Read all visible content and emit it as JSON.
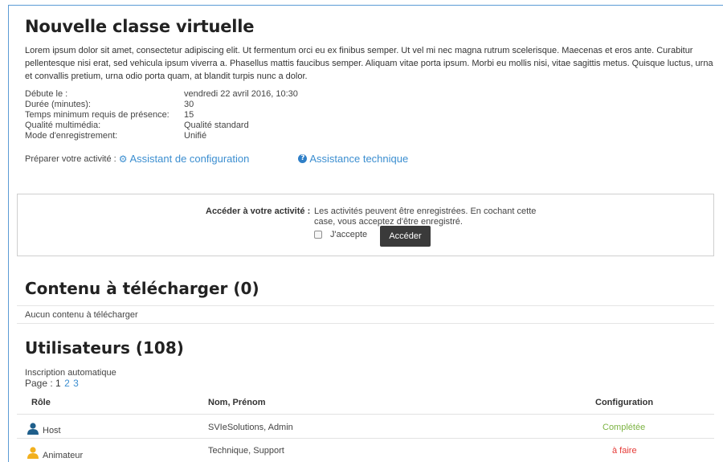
{
  "title": "Nouvelle classe virtuelle",
  "description": "Lorem ipsum dolor sit amet, consectetur adipiscing elit. Ut fermentum orci eu ex finibus semper. Ut vel mi nec magna rutrum scelerisque. Maecenas et eros ante. Curabitur pellentesque nisi erat, sed vehicula ipsum viverra a. Phasellus mattis faucibus semper. Aliquam vitae porta ipsum. Morbi eu mollis nisi, vitae sagittis metus. Quisque luctus, urna et convallis pretium, urna odio porta quam, at blandit turpis nunc a dolor.",
  "details": [
    {
      "label": "Débute le :",
      "value": "vendredi 22 avril 2016, 10:30"
    },
    {
      "label": "Durée (minutes):",
      "value": "30"
    },
    {
      "label": "Temps minimum requis de présence:",
      "value": "15"
    },
    {
      "label": "Qualité multimédia:",
      "value": "Qualité standard"
    },
    {
      "label": "Mode d'enregistrement:",
      "value": "Unifié"
    }
  ],
  "prepare": {
    "label": "Préparer votre activité :",
    "wizard_icon": "gear-icon",
    "wizard_link": "Assistant de configuration",
    "support_icon": "question-circle-icon",
    "support_link": "Assistance technique"
  },
  "access": {
    "label": "Accéder à votre activité :",
    "notice": "Les activités peuvent être enregistrées. En cochant cette case, vous acceptez d'être enregistré.",
    "checkbox_label": "J'accepte",
    "checkbox_checked": false,
    "button_label": "Accéder"
  },
  "downloads": {
    "heading": "Contenu à télécharger (0)",
    "empty_text": "Aucun contenu à télécharger"
  },
  "users": {
    "heading": "Utilisateurs (108)",
    "enrolment": "Inscription automatique",
    "page_label": "Page :",
    "pages": [
      "1",
      "2",
      "3"
    ],
    "current_page": "1",
    "columns": {
      "role": "Rôle",
      "name": "Nom, Prénom",
      "config": "Configuration"
    },
    "rows": [
      {
        "role": "Host",
        "name": "SVIeSolutions, Admin",
        "config": "Complétée",
        "icon": "user-icon",
        "icon_color": "#1f5f8b",
        "status_color": "#7cb342"
      },
      {
        "role": "Animateur",
        "name": "Technique, Support",
        "config": "à faire",
        "icon": "user-icon",
        "icon_color": "#f2b01e",
        "status_color": "#e53935"
      }
    ]
  },
  "colors": {
    "link": "#3b8ed0",
    "frame_border": "#5b9bd5",
    "button": "#3a3a3a"
  }
}
